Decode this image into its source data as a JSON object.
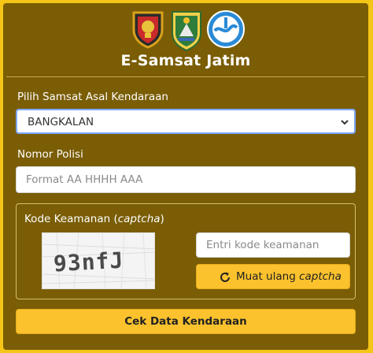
{
  "header": {
    "title": "E-Samsat Jatim",
    "logos": [
      "police-shield-logo",
      "east-java-province-logo",
      "jasa-raharja-logo"
    ]
  },
  "form": {
    "samsat_label": "Pilih Samsat Asal Kendaraan",
    "samsat_selected": "BANGKALAN",
    "nopol_label": "Nomor Polisi",
    "nopol_placeholder": "Format AA HHHH AAA",
    "captcha_label_prefix": "Kode Keamanan (",
    "captcha_label_em": "captcha",
    "captcha_label_suffix": ")",
    "captcha_text": "93nfJ",
    "captcha_input_placeholder": "Entri kode keamanan",
    "reload_prefix": "Muat ulang ",
    "reload_em": "captcha",
    "submit_label": "Cek Data Kendaraan"
  },
  "colors": {
    "background": "#f5c518",
    "panel": "#7a5d05",
    "button": "#fbc22d",
    "select_border": "#7fa6ff"
  }
}
